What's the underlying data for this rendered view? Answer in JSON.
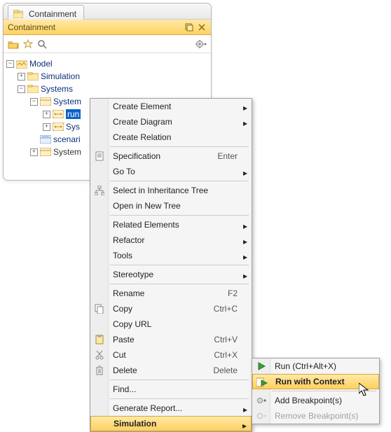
{
  "tab": {
    "label": "Containment"
  },
  "titlebar": {
    "title": "Containment"
  },
  "tree": {
    "root": "Model",
    "n_simulation": "Simulation",
    "n_systems": "Systems",
    "n_system": "System",
    "n_run": "run",
    "n_sys2": "Sys",
    "n_scenario": "scenari",
    "n_system1": "System"
  },
  "contextMenu": {
    "createElement": "Create Element",
    "createDiagram": "Create Diagram",
    "createRelation": "Create Relation",
    "specification": "Specification",
    "specification_sc": "Enter",
    "goTo": "Go To",
    "selectInheritance": "Select in Inheritance Tree",
    "openNewTree": "Open in New Tree",
    "relatedElements": "Related Elements",
    "refactor": "Refactor",
    "tools": "Tools",
    "stereotype": "Stereotype",
    "rename": "Rename",
    "rename_sc": "F2",
    "copy": "Copy",
    "copy_sc": "Ctrl+C",
    "copyUrl": "Copy URL",
    "paste": "Paste",
    "paste_sc": "Ctrl+V",
    "cut": "Cut",
    "cut_sc": "Ctrl+X",
    "delete": "Delete",
    "delete_sc": "Delete",
    "find": "Find...",
    "generateReport": "Generate Report...",
    "simulation": "Simulation"
  },
  "submenu": {
    "run": "Run (Ctrl+Alt+X)",
    "runContext": "Run with Context",
    "addBp": "Add Breakpoint(s)",
    "removeBp": "Remove Breakpoint(s)"
  }
}
